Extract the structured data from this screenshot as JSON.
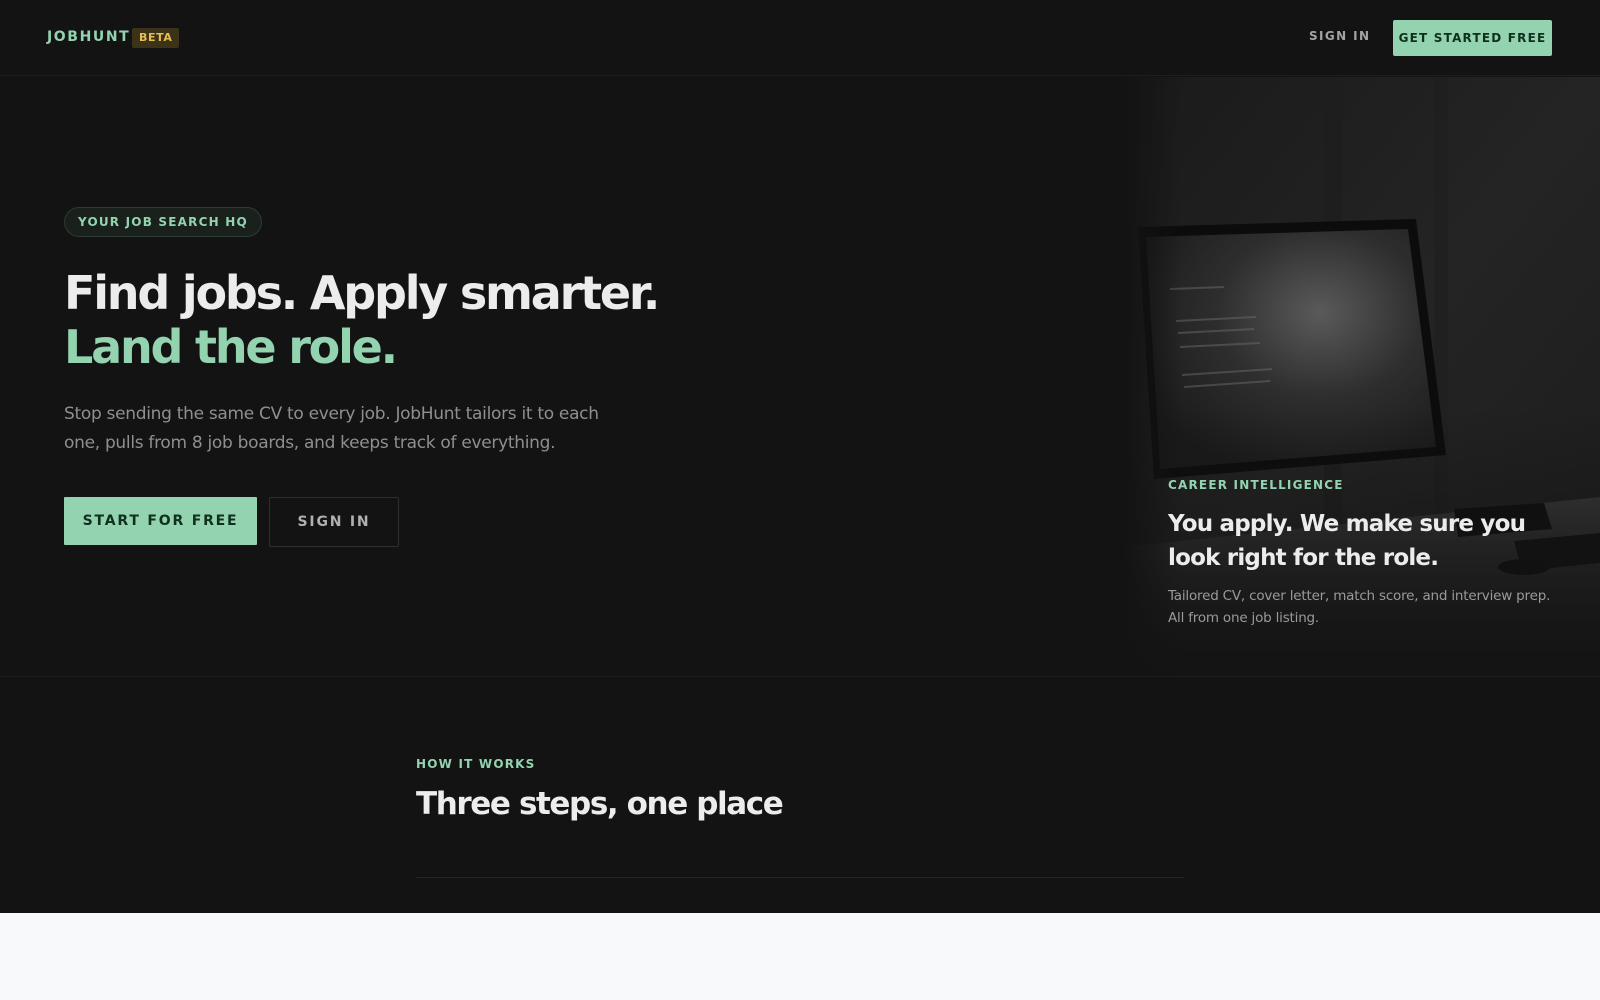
{
  "header": {
    "logo": "JOBHUNT",
    "badge": "BETA",
    "sign_in": "SIGN IN",
    "cta": "GET STARTED FREE"
  },
  "hero": {
    "eyebrow": "YOUR JOB SEARCH HQ",
    "title_line1": "Find jobs. Apply smarter.",
    "title_line2": "Land the role.",
    "subtitle": "Stop sending the same CV to every job. JobHunt tailors it to each one, pulls from 8 job boards, and keeps track of everything.",
    "primary_button": "START FOR FREE",
    "secondary_button": "SIGN IN"
  },
  "visual_card": {
    "kicker": "CAREER INTELLIGENCE",
    "title": "You apply. We make sure you look right for the role.",
    "subtitle": "Tailored CV, cover letter, match score, and interview prep. All from one job listing."
  },
  "how_it_works": {
    "kicker": "HOW IT WORKS",
    "title": "Three steps, one place"
  },
  "colors": {
    "background": "#131313",
    "accent": "#93d3b0",
    "beta_badge": "#e6be55",
    "lower_background": "#f8f9fb"
  }
}
